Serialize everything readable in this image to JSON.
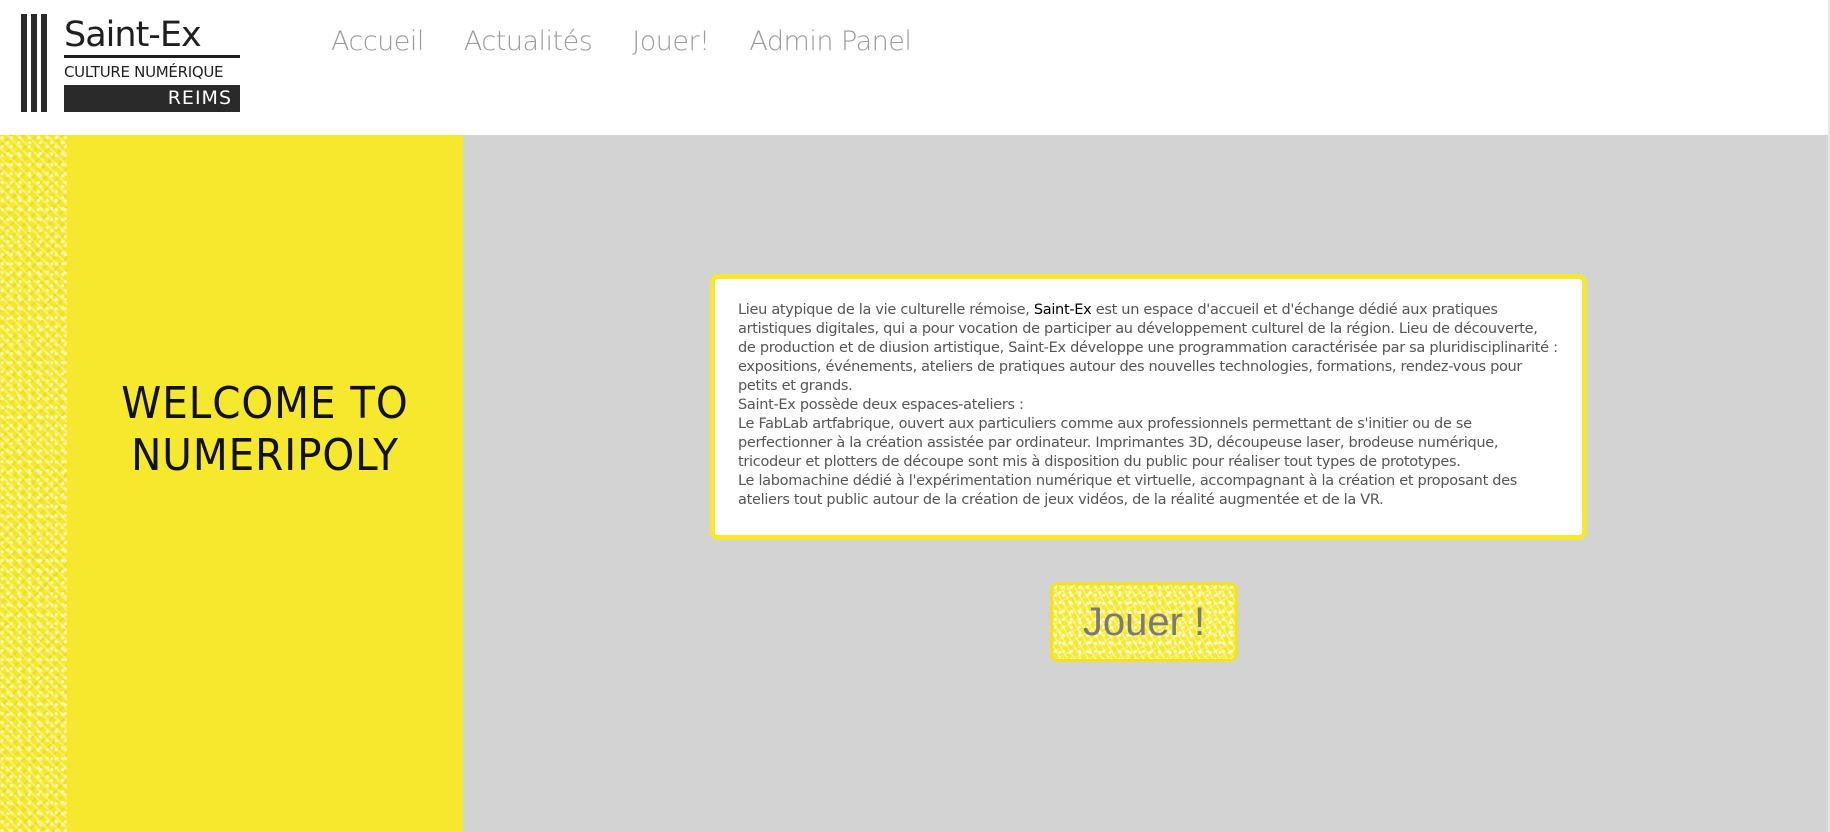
{
  "header": {
    "logo": {
      "title": "Saint-Ex",
      "subtitle": "CULTURE NUMÉRIQUE",
      "city": "REIMS"
    },
    "nav": [
      {
        "label": "Accueil",
        "name": "nav-accueil"
      },
      {
        "label": "Actualités",
        "name": "nav-actualites"
      },
      {
        "label": "Jouer!",
        "name": "nav-jouer"
      },
      {
        "label": "Admin Panel",
        "name": "nav-admin-panel"
      }
    ]
  },
  "welcome": {
    "line1": "WELCOME TO",
    "line2": "NUMERIPOLY"
  },
  "info": {
    "p1_before": "Lieu atypique de la vie culturelle rémoise, ",
    "p1_brand": "Saint-Ex",
    "p1_after": " est un espace d'accueil et d'échange dédié aux pratiques artistiques digitales, qui a pour vocation de participer au développement culturel de la région. Lieu de découverte, de production et de diusion artistique, Saint-Ex développe une programmation caractérisée par sa pluridisciplinarité : expositions, événements, ateliers de pratiques autour des nouvelles technologies, formations, rendez-vous pour petits et grands.",
    "p2": "Saint-Ex possède deux espaces-ateliers :",
    "p3": "Le FabLab artfabrique, ouvert aux particuliers comme aux professionnels permettant de s'initier ou de se perfectionner à la création assistée par ordinateur. Imprimantes 3D, découpeuse laser, brodeuse numérique, tricodeur et plotters de découpe sont mis à disposition du public pour réaliser tout types de prototypes.",
    "p4": "Le labomachine dédié à l'expérimentation numérique et virtuelle, accompagnant à la création et proposant des ateliers tout public autour de la création de jeux vidéos, de la réalité augmentée et de la VR."
  },
  "play_button": {
    "label": "Jouer !"
  },
  "colors": {
    "accent": "#f6e82d",
    "background": "#d3d3d3",
    "text": "#555555"
  }
}
